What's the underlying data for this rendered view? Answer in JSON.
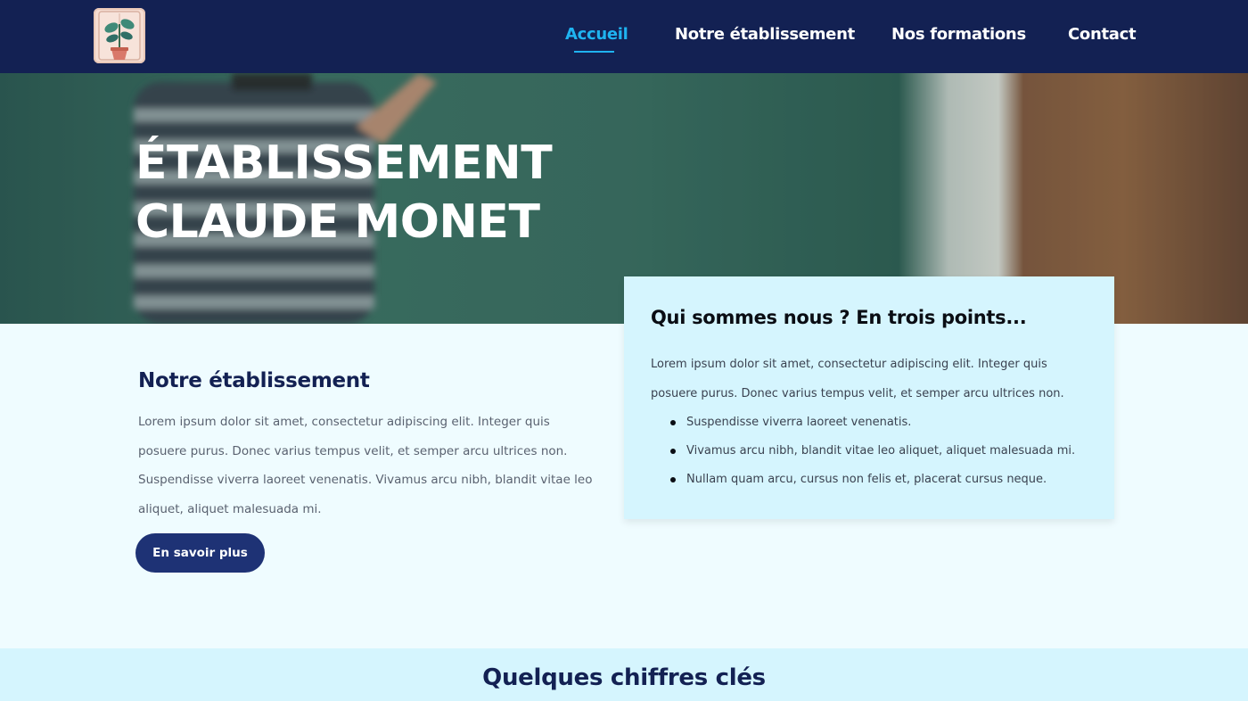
{
  "header": {
    "logo_icon": "plant-book-icon",
    "nav": [
      {
        "label": "Accueil",
        "active": true
      },
      {
        "label": "Notre établissement",
        "active": false
      },
      {
        "label": "Nos formations",
        "active": false
      },
      {
        "label": "Contact",
        "active": false
      }
    ]
  },
  "hero": {
    "title_line1": "ÉTABLISSEMENT",
    "title_line2": "CLAUDE MONET"
  },
  "about": {
    "title": "Notre établissement",
    "text": "Lorem ipsum dolor sit amet, consectetur adipiscing elit. Integer quis posuere purus. Donec varius tempus velit, et semper arcu ultrices non. Suspendisse viverra laoreet venenatis. Vivamus arcu nibh, blandit vitae leo aliquet, aliquet malesuada mi.",
    "button_label": "En savoir plus"
  },
  "card": {
    "title": "Qui sommes nous ? En trois points...",
    "text": "Lorem ipsum dolor sit amet, consectetur adipiscing elit. Integer quis posuere purus. Donec varius tempus velit, et semper arcu ultrices non.",
    "points": [
      "Suspendisse viverra laoreet venenatis.",
      "Vivamus arcu nibh, blandit vitae leo aliquet, aliquet malesuada mi.",
      "Nullam quam arcu, cursus non felis et, placerat cursus neque."
    ]
  },
  "figures": {
    "title": "Quelques chiffres clés"
  },
  "colors": {
    "header_bg": "#132153",
    "accent": "#1fb3f0",
    "button_bg": "#1e3275",
    "page_bg": "#effcff",
    "card_bg": "#d5f5fe"
  }
}
